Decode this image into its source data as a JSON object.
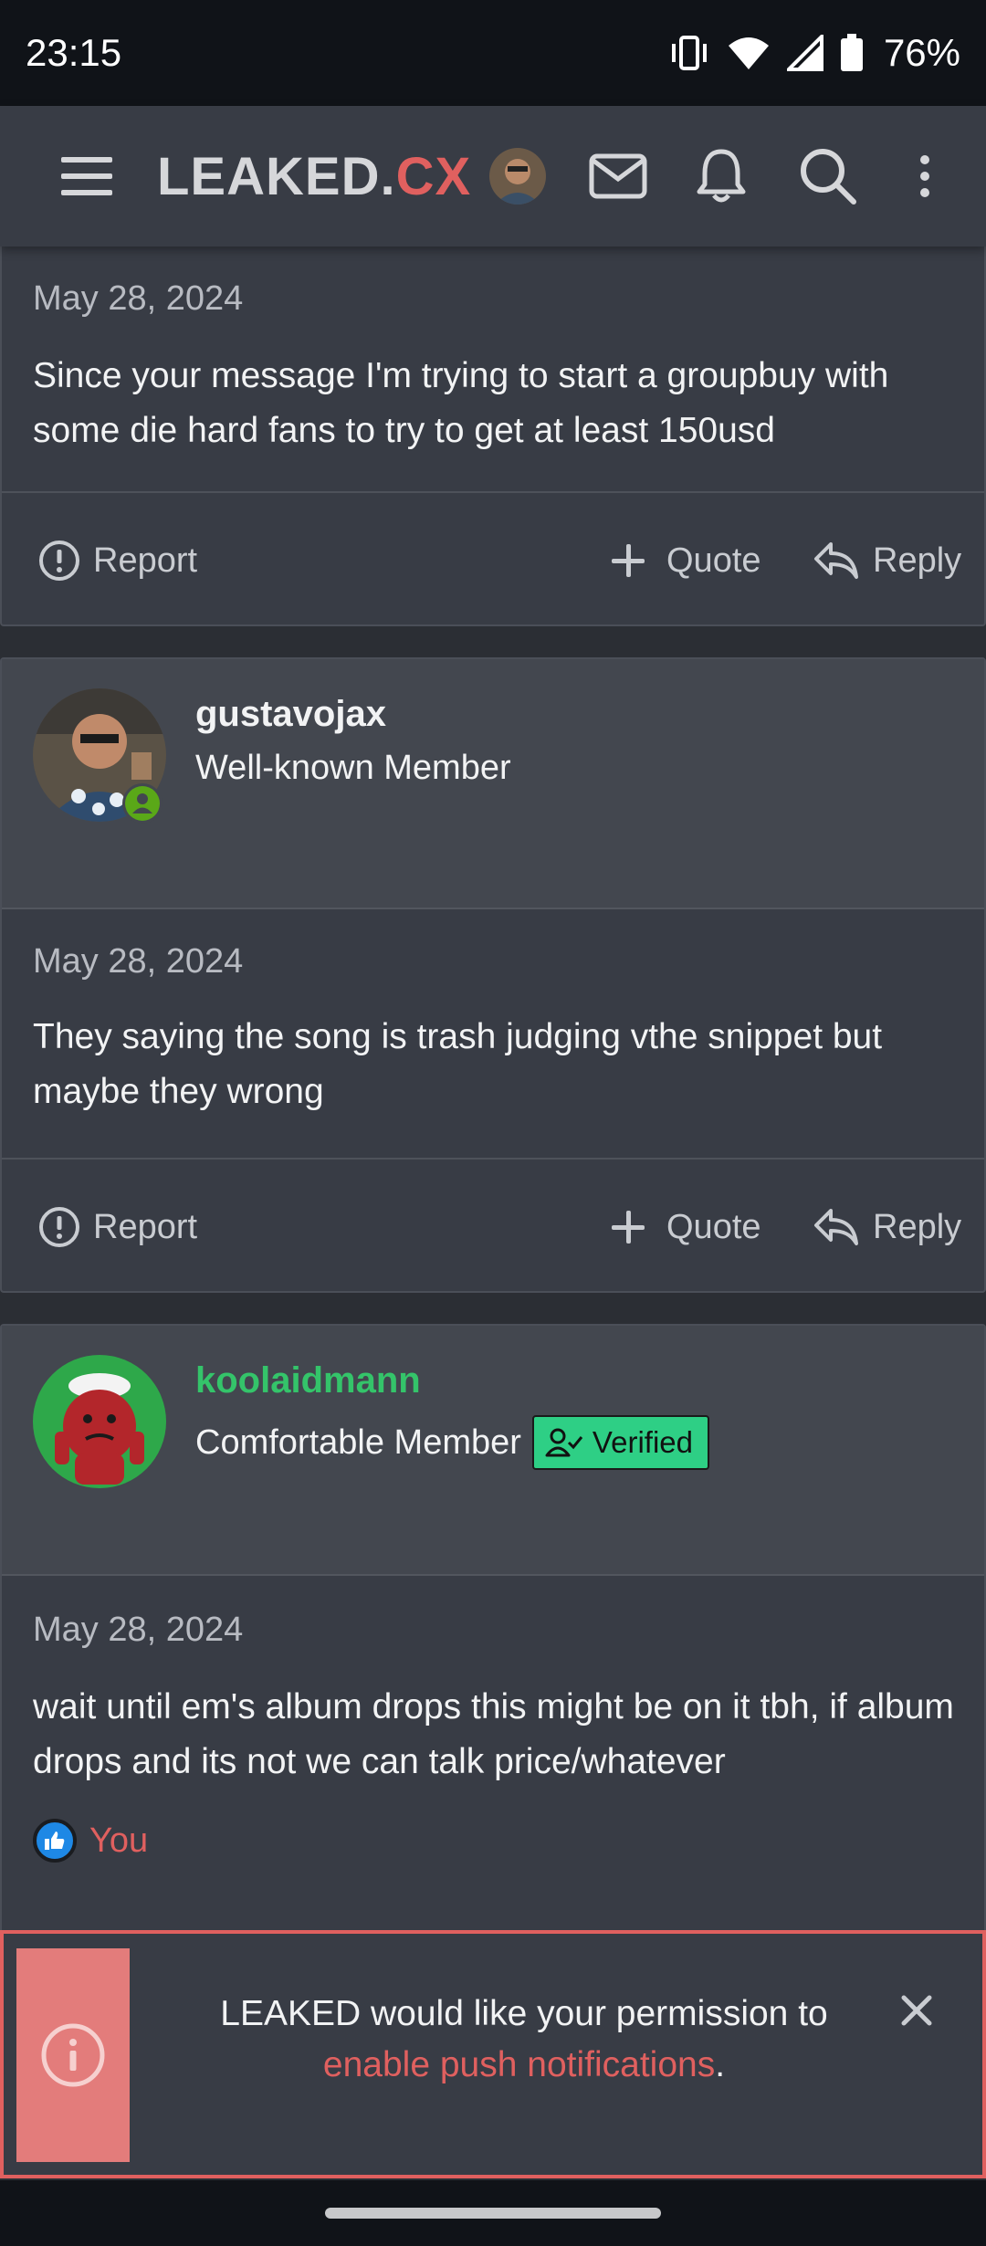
{
  "status_bar": {
    "time": "23:15",
    "battery_text": "76%",
    "icons": [
      "vibrate-icon",
      "wifi-icon",
      "signal-icon",
      "battery-icon"
    ]
  },
  "header": {
    "logo_part1": "LEAKED.",
    "logo_part2": "CX",
    "brand_color": "#e0605f",
    "icons": [
      "menu-icon",
      "avatar",
      "mail-icon",
      "bell-icon",
      "search-icon",
      "more-vertical-icon"
    ]
  },
  "posts": [
    {
      "date": "May 28, 2024",
      "text": "Since your message I'm trying to start a groupbuy with some die hard fans to try to get at least 150usd",
      "actions": {
        "report": "Report",
        "quote": "Quote",
        "reply": "Reply"
      }
    },
    {
      "username": "gustavojax",
      "user_title": "Well-known Member",
      "online": true,
      "date": "May 28, 2024",
      "text": "They saying the song is trash judging vthe snippet but maybe they wrong",
      "actions": {
        "report": "Report",
        "quote": "Quote",
        "reply": "Reply"
      }
    },
    {
      "username": "koolaidmann",
      "username_color": "#34c46a",
      "user_title": "Comfortable Member",
      "badge": "Verified",
      "date": "May 28, 2024",
      "text": "wait until em's album drops this might be on it tbh, if album drops and its not we can talk price/whatever",
      "reaction": "You"
    }
  ],
  "notification": {
    "text_before": "LEAKED would like your permission to",
    "link_text": "enable push notifications",
    "text_after": "."
  }
}
